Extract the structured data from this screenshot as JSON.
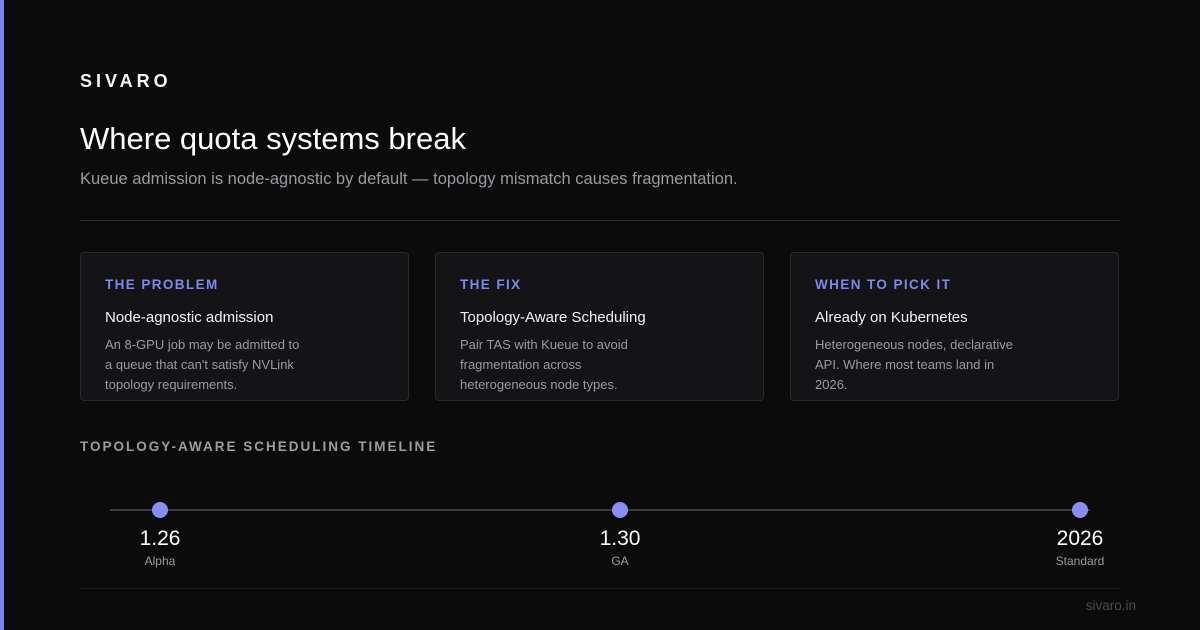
{
  "brand": "SIVARO",
  "title": "Where quota systems break",
  "subtitle": "Kueue admission is node-agnostic by default — topology mismatch causes fragmentation.",
  "cards": [
    {
      "label": "THE PROBLEM",
      "heading": "Node-agnostic admission",
      "body": "An 8-GPU job may be admitted to a queue that can't satisfy NVLink topology requirements."
    },
    {
      "label": "THE FIX",
      "heading": "Topology-Aware Scheduling",
      "body": "Pair TAS with Kueue to avoid fragmentation across heterogeneous node types."
    },
    {
      "label": "WHEN TO PICK IT",
      "heading": "Already on Kubernetes",
      "body": "Heterogeneous nodes, declarative API. Where most teams land in 2026."
    }
  ],
  "timeline": {
    "label": "TOPOLOGY-AWARE SCHEDULING TIMELINE",
    "milestones": [
      {
        "version": "1.26",
        "stage": "Alpha"
      },
      {
        "version": "1.30",
        "stage": "GA"
      },
      {
        "version": "2026",
        "stage": "Standard"
      }
    ]
  },
  "footer": {
    "site": "sivaro.in"
  },
  "colors": {
    "accent": "#7c80f0",
    "background": "#0b0b0c",
    "card_background": "#141416"
  }
}
